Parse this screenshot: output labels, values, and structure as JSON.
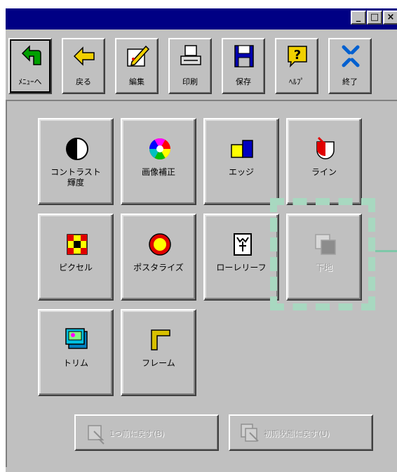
{
  "titlebar": {
    "minimize": "_",
    "maximize": "□",
    "close": "×"
  },
  "toolbar": [
    {
      "label": "ﾒﾆｭｰへ",
      "icon": "menu-back-arrow-icon"
    },
    {
      "label": "戻る",
      "icon": "back-arrow-icon"
    },
    {
      "label": "編集",
      "icon": "edit-pencil-icon"
    },
    {
      "label": "印刷",
      "icon": "printer-icon"
    },
    {
      "label": "保存",
      "icon": "floppy-disk-icon"
    },
    {
      "label": "ﾍﾙﾌﾟ",
      "icon": "help-question-icon"
    },
    {
      "label": "終了",
      "icon": "exit-icon"
    }
  ],
  "effects": [
    {
      "label1": "コントラスト",
      "label2": "輝度",
      "icon": "contrast-icon"
    },
    {
      "label1": "画像補正",
      "label2": "",
      "icon": "color-wheel-icon"
    },
    {
      "label1": "エッジ",
      "label2": "",
      "icon": "edge-icon"
    },
    {
      "label1": "ライン",
      "label2": "",
      "icon": "line-icon"
    },
    {
      "label1": "ピクセル",
      "label2": "",
      "icon": "pixel-icon"
    },
    {
      "label1": "ポスタライズ",
      "label2": "",
      "icon": "posterize-icon"
    },
    {
      "label1": "ローレリーフ",
      "label2": "",
      "icon": "relief-icon"
    },
    {
      "label1": "下地",
      "label2": "",
      "icon": "background-layer-icon",
      "disabled": true
    },
    {
      "label1": "トリム",
      "label2": "",
      "icon": "trim-icon"
    },
    {
      "label1": "フレーム",
      "label2": "",
      "icon": "frame-icon"
    }
  ],
  "bottom": {
    "undo_label": "1つ前に戻す(B)",
    "reset_label": "初期状態に戻す(U)"
  },
  "colors": {
    "title_bar": "#000084",
    "face": "#c0c0c0",
    "selection_dash": "#a8d8c0"
  }
}
